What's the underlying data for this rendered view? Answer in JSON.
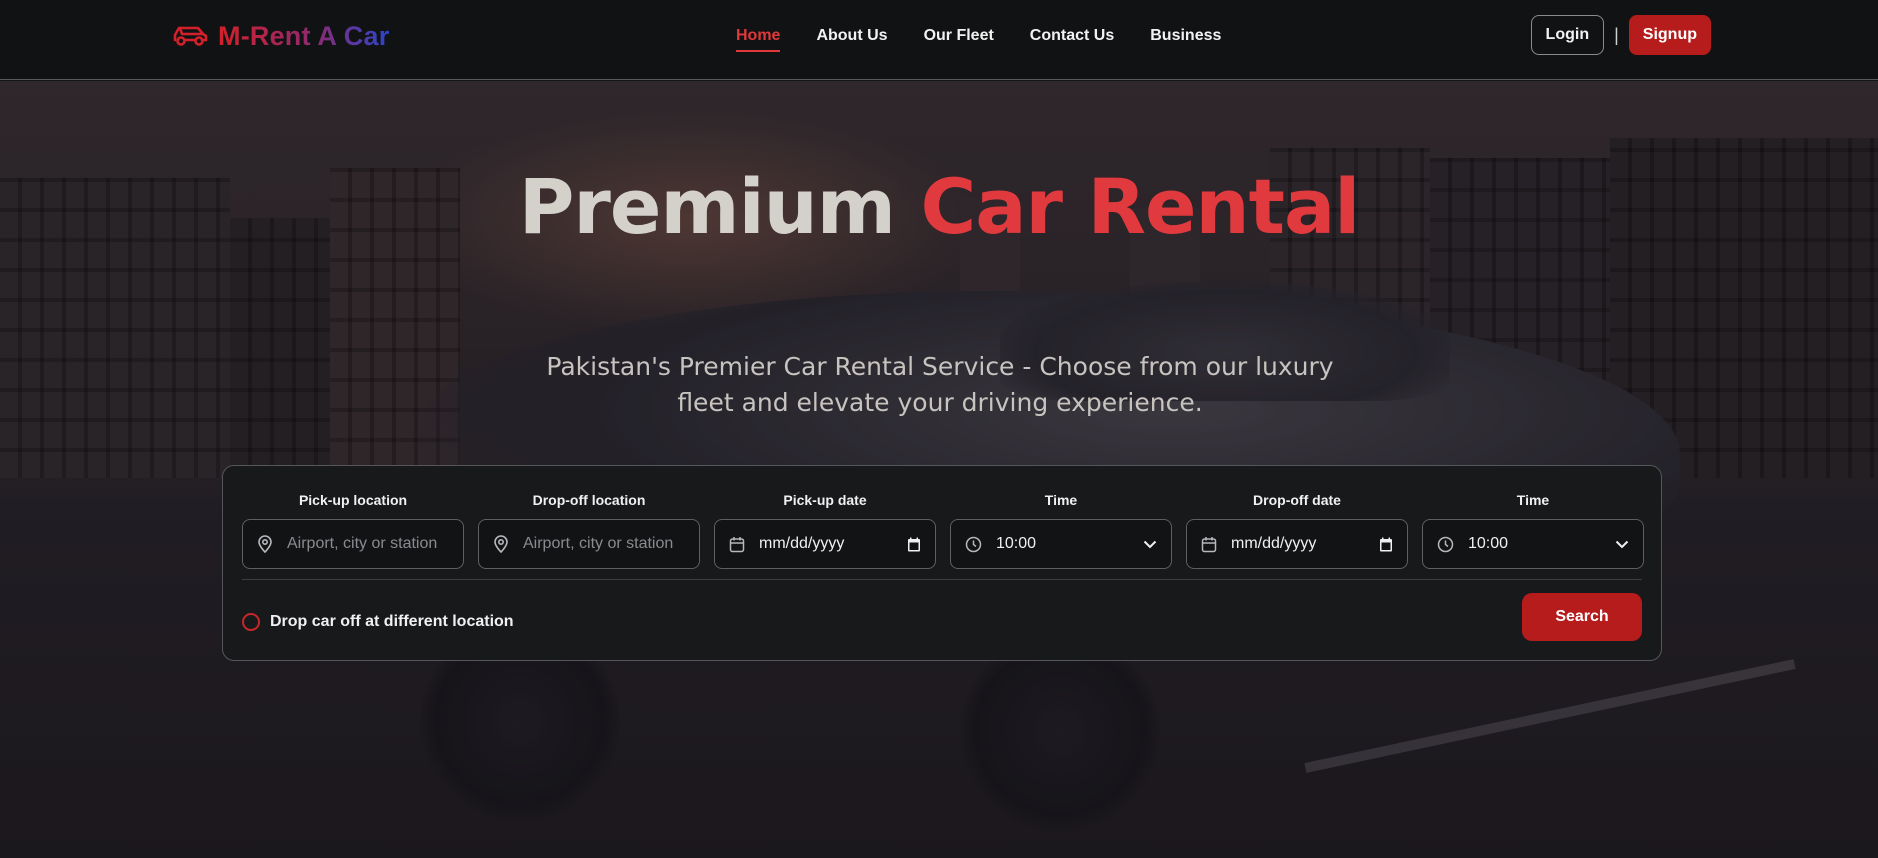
{
  "brand": {
    "name": "M-Rent A Car",
    "icon": "car-icon"
  },
  "nav": {
    "links": [
      {
        "label": "Home",
        "active": true
      },
      {
        "label": "About Us"
      },
      {
        "label": "Our Fleet"
      },
      {
        "label": "Contact Us"
      },
      {
        "label": "Business"
      }
    ],
    "login_label": "Login",
    "divider": "|",
    "signup_label": "Signup"
  },
  "hero": {
    "title_part1": "Premium",
    "title_part2": "Car Rental",
    "subtitle": "Pakistan's Premier Car Rental Service - Choose from our luxury fleet and elevate your driving experience."
  },
  "search": {
    "pickup_location": {
      "label": "Pick-up location",
      "placeholder": "Airport, city or station",
      "icon": "map-pin-icon"
    },
    "dropoff_location": {
      "label": "Drop-off location",
      "placeholder": "Airport, city or station",
      "icon": "map-pin-icon"
    },
    "pickup_date": {
      "label": "Pick-up date",
      "value": "mm/dd/yyyy",
      "icon": "calendar-icon"
    },
    "pickup_time": {
      "label": "Time",
      "value": "10:00",
      "icon": "clock-icon"
    },
    "dropoff_date": {
      "label": "Drop-off date",
      "value": "mm/dd/yyyy",
      "icon": "calendar-icon"
    },
    "dropoff_time": {
      "label": "Time",
      "value": "10:00",
      "icon": "clock-icon"
    },
    "drop_different_label": "Drop car off at different location",
    "search_label": "Search"
  },
  "colors": {
    "accent_red": "#e03a3e",
    "button_red": "#b71c1c",
    "brand_gradient_start": "#d4202a",
    "brand_gradient_end": "#2c45c9",
    "nav_bg": "#111214",
    "panel_bg": "#18191b"
  }
}
